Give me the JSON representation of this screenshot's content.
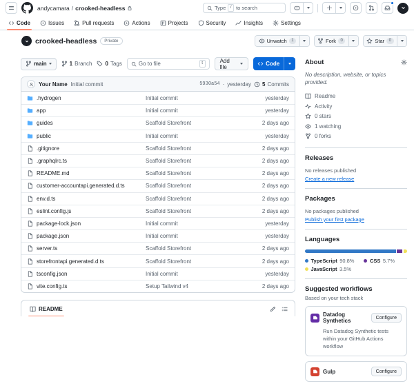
{
  "colors": {
    "accent": "#0969da",
    "tab_underline": "#fd8c73",
    "folder_icon": "#54aeff"
  },
  "header": {
    "breadcrumb": {
      "owner": "andycamara",
      "separator": "/",
      "repo": "crooked-headless"
    },
    "search": {
      "prefix": "Type",
      "key": "/",
      "suffix": "to search"
    },
    "right_icons": [
      "copilot",
      "plus",
      "issue-opened",
      "pull-request",
      "inbox",
      "avatar"
    ]
  },
  "tabs": [
    {
      "label": "Code",
      "icon": "code",
      "active": true
    },
    {
      "label": "Issues",
      "icon": "issue",
      "active": false
    },
    {
      "label": "Pull requests",
      "icon": "pr",
      "active": false
    },
    {
      "label": "Actions",
      "icon": "play",
      "active": false
    },
    {
      "label": "Projects",
      "icon": "project",
      "active": false
    },
    {
      "label": "Security",
      "icon": "shield",
      "active": false
    },
    {
      "label": "Insights",
      "icon": "graph",
      "active": false
    },
    {
      "label": "Settings",
      "icon": "gear",
      "active": false
    }
  ],
  "repo": {
    "name": "crooked-headless",
    "visibility": "Private",
    "actions": {
      "watch": {
        "label": "Unwatch",
        "count": "1"
      },
      "fork": {
        "label": "Fork",
        "count": "0"
      },
      "star": {
        "label": "Star",
        "count": "0"
      }
    }
  },
  "toolbar": {
    "branch": "main",
    "branches_count": "1",
    "branches_label": "Branch",
    "tags_count": "0",
    "tags_label": "Tags",
    "goto_placeholder": "Go to file",
    "goto_kbd": "t",
    "add_file_label": "Add file",
    "code_label": "Code"
  },
  "commit_bar": {
    "author": "Your Name",
    "message": "Initial commit",
    "sha": "5930a54",
    "dot": "·",
    "time": "yesterday",
    "commits_count": "5",
    "commits_label": "Commits"
  },
  "files": {
    "rows": [
      {
        "name": ".hydrogen",
        "type": "dir",
        "message": "Initial commit",
        "date": "yesterday"
      },
      {
        "name": "app",
        "type": "dir",
        "message": "Initial commit",
        "date": "yesterday"
      },
      {
        "name": "guides",
        "type": "dir",
        "message": "Scaffold Storefront",
        "date": "2 days ago"
      },
      {
        "name": "public",
        "type": "dir",
        "message": "Initial commit",
        "date": "yesterday"
      },
      {
        "name": ".gitignore",
        "type": "file",
        "message": "Scaffold Storefront",
        "date": "2 days ago"
      },
      {
        "name": ".graphqlrc.ts",
        "type": "file",
        "message": "Scaffold Storefront",
        "date": "2 days ago"
      },
      {
        "name": "README.md",
        "type": "file",
        "message": "Scaffold Storefront",
        "date": "2 days ago"
      },
      {
        "name": "customer-accountapi.generated.d.ts",
        "type": "file",
        "message": "Scaffold Storefront",
        "date": "2 days ago"
      },
      {
        "name": "env.d.ts",
        "type": "file",
        "message": "Scaffold Storefront",
        "date": "2 days ago"
      },
      {
        "name": "eslint.config.js",
        "type": "file",
        "message": "Scaffold Storefront",
        "date": "2 days ago"
      },
      {
        "name": "package-lock.json",
        "type": "file",
        "message": "Initial commit",
        "date": "yesterday"
      },
      {
        "name": "package.json",
        "type": "file",
        "message": "Initial commit",
        "date": "yesterday"
      },
      {
        "name": "server.ts",
        "type": "file",
        "message": "Scaffold Storefront",
        "date": "2 days ago"
      },
      {
        "name": "storefrontapi.generated.d.ts",
        "type": "file",
        "message": "Scaffold Storefront",
        "date": "2 days ago"
      },
      {
        "name": "tsconfig.json",
        "type": "file",
        "message": "Initial commit",
        "date": "yesterday"
      },
      {
        "name": "vite.config.ts",
        "type": "file",
        "message": "Setup Tailwind v4",
        "date": "2 days ago"
      }
    ]
  },
  "readme": {
    "title": "README"
  },
  "sidebar": {
    "about": {
      "title": "About",
      "description": "No description, website, or topics provided.",
      "stats": [
        {
          "icon": "book",
          "label": "Readme"
        },
        {
          "icon": "pulse",
          "label": "Activity"
        },
        {
          "icon": "star",
          "label": "0 stars"
        },
        {
          "icon": "eye",
          "label": "1 watching"
        },
        {
          "icon": "fork",
          "label": "0 forks"
        }
      ]
    },
    "releases": {
      "title": "Releases",
      "empty": "No releases published",
      "link": "Create a new release"
    },
    "packages": {
      "title": "Packages",
      "empty": "No packages published",
      "link": "Publish your first package"
    },
    "languages": {
      "title": "Languages",
      "items": [
        {
          "name": "TypeScript",
          "pct": "90.8%",
          "value": 90.8,
          "color": "#3178c6"
        },
        {
          "name": "CSS",
          "pct": "5.7%",
          "value": 5.7,
          "color": "#663399"
        },
        {
          "name": "JavaScript",
          "pct": "3.5%",
          "value": 3.5,
          "color": "#f1e05a"
        }
      ]
    },
    "workflows": {
      "title": "Suggested workflows",
      "subtitle": "Based on your tech stack",
      "configure_label": "Configure",
      "cards": [
        {
          "name": "Datadog Synthetics",
          "color": "#632ca6",
          "description": "Run Datadog Synthetic tests within your GitHub Actions workflow"
        },
        {
          "name": "Gulp",
          "color": "#d34231",
          "description": ""
        }
      ]
    }
  }
}
